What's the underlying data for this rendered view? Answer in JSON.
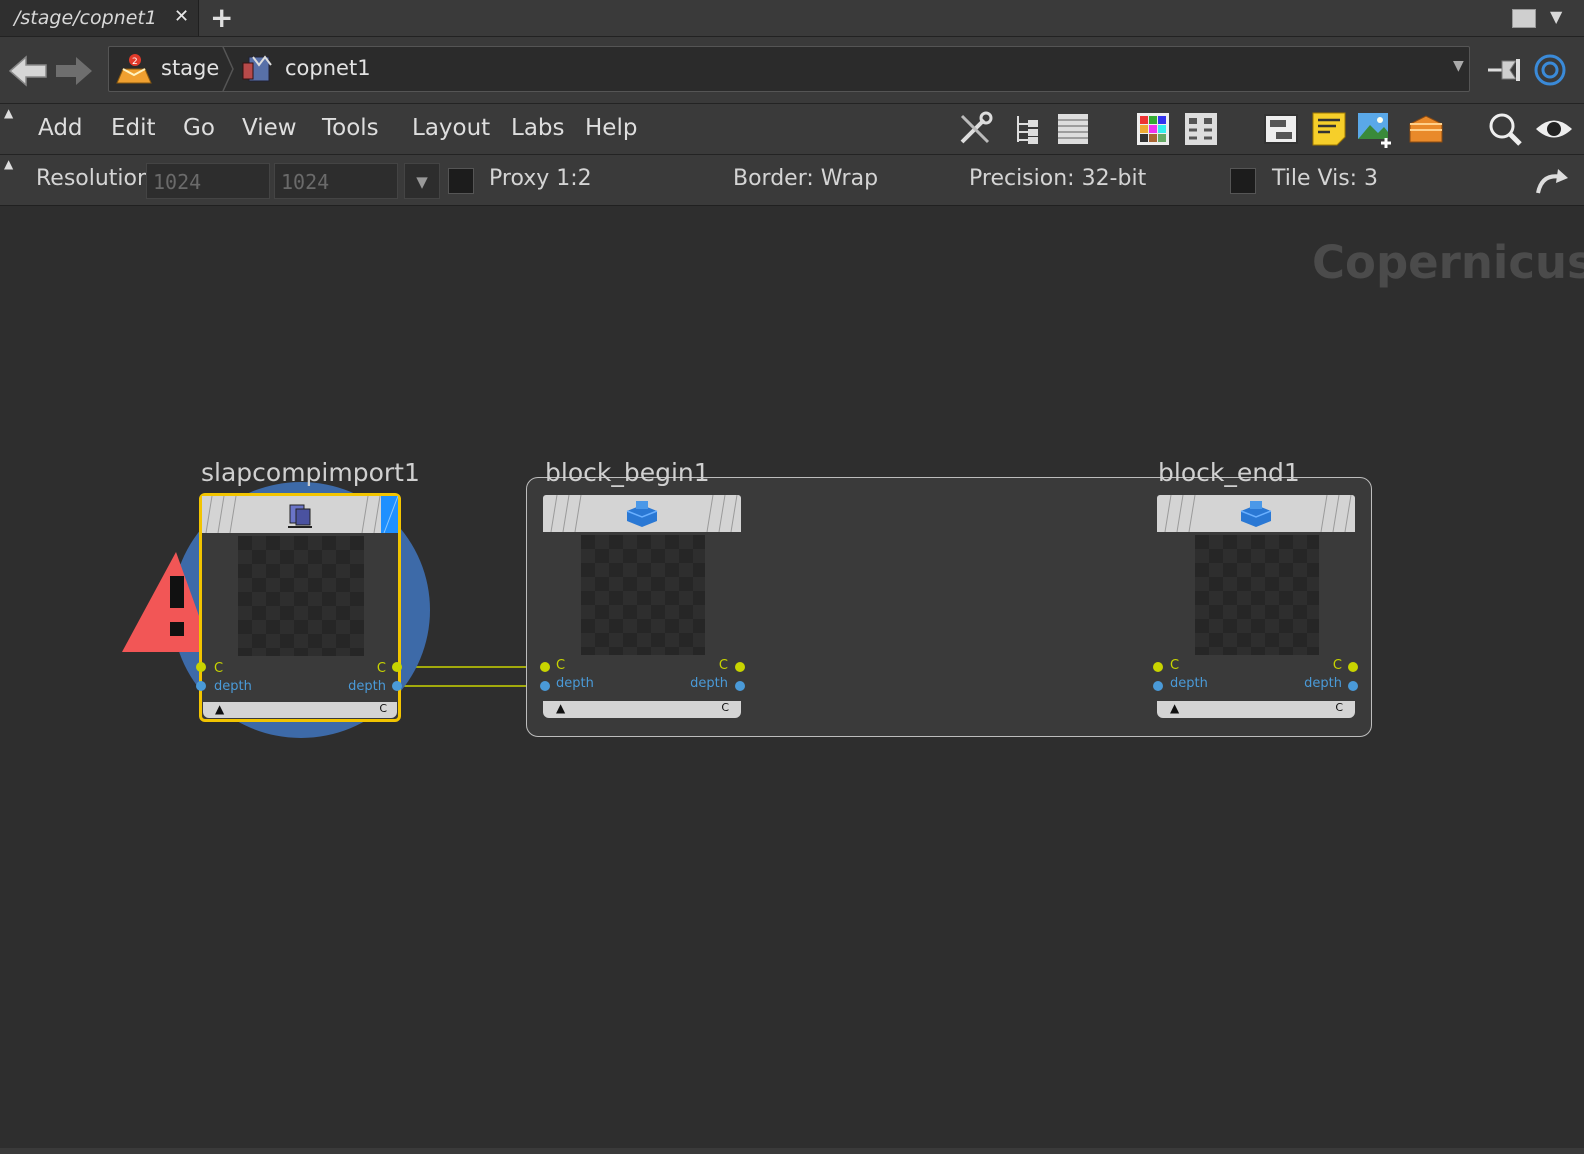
{
  "tab": {
    "title": "/stage/copnet1",
    "close": "✕",
    "add": "+"
  },
  "path": {
    "crumbs": [
      "stage",
      "copnet1"
    ]
  },
  "menu": [
    "Add",
    "Edit",
    "Go",
    "View",
    "Tools",
    "Layout",
    "Labs",
    "Help"
  ],
  "toolbar_icons": [
    "tools-icon",
    "tree-view-icon",
    "list-view-icon",
    "color-palette-icon",
    "shape-palette-icon",
    "network-box-icon",
    "sticky-note-icon",
    "add-image-icon",
    "subnet-box-icon",
    "search-icon",
    "visibility-icon"
  ],
  "options": {
    "resolution_label": "Resolution",
    "res_x": "1024",
    "res_y": "1024",
    "proxy": "Proxy 1:2",
    "border": "Border: Wrap",
    "precision": "Precision: 32-bit",
    "tile_vis": "Tile Vis: 3"
  },
  "canvas": {
    "context_label": "Copernicus",
    "nodes": [
      {
        "name": "slapcompimport1",
        "in_ports": [
          "C",
          "depth"
        ],
        "out_ports": [
          "C",
          "depth"
        ],
        "footer_flag": "C",
        "selected": true,
        "has_error": true
      },
      {
        "name": "block_begin1",
        "in_ports": [
          "C",
          "depth"
        ],
        "out_ports": [
          "C",
          "depth"
        ],
        "footer_flag": "C"
      },
      {
        "name": "block_end1",
        "in_ports": [
          "C",
          "depth"
        ],
        "out_ports": [
          "C",
          "depth"
        ],
        "footer_flag": "C"
      }
    ]
  },
  "colors": {
    "port_c": "#c8d400",
    "port_depth": "#4a9ad8",
    "selected_outline": "#f2c400",
    "error_badge": "#f25656",
    "node_header": "#d4d4d4"
  }
}
